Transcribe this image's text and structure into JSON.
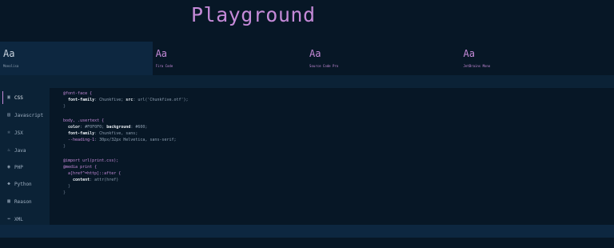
{
  "title": "Playground",
  "fonts": [
    {
      "sample": "Aa",
      "name": "Monolisa"
    },
    {
      "sample": "Aa",
      "name": "Fira Code"
    },
    {
      "sample": "Aa",
      "name": "Source Code Pro"
    },
    {
      "sample": "Aa",
      "name": "JetBrains Mono"
    }
  ],
  "languages": [
    "CSS",
    "Javascript",
    "JSX",
    "Java",
    "PHP",
    "Python",
    "Reason",
    "XML"
  ],
  "code": {
    "l1": "@font-face {",
    "l2a": "  font-family",
    "l2b": ": Chunkfive; ",
    "l2c": "src",
    "l2d": ": url('Chunkfive.otf');",
    "l3": "}",
    "l5": "body, .usertext {",
    "l6a": "  color",
    "l6b": ": #F0F0F0; ",
    "l6c": "background",
    "l6d": ": #600;",
    "l7a": "  font-family",
    "l7b": ": Chunkfive, sans;",
    "l8a": "  --heading-1",
    "l8b": ": 30px/32px Helvetica, sans-serif;",
    "l9": "}",
    "l11": "@import url(print.css);",
    "l12": "@media print {",
    "l13": "  a[href^=http]::after {",
    "l14a": "    content",
    "l14b": ": attr(href)",
    "l15": "  }",
    "l16": "}"
  },
  "colors": {
    "accent": "#c58ad8",
    "background": "#071726",
    "panel": "#0b2236"
  }
}
